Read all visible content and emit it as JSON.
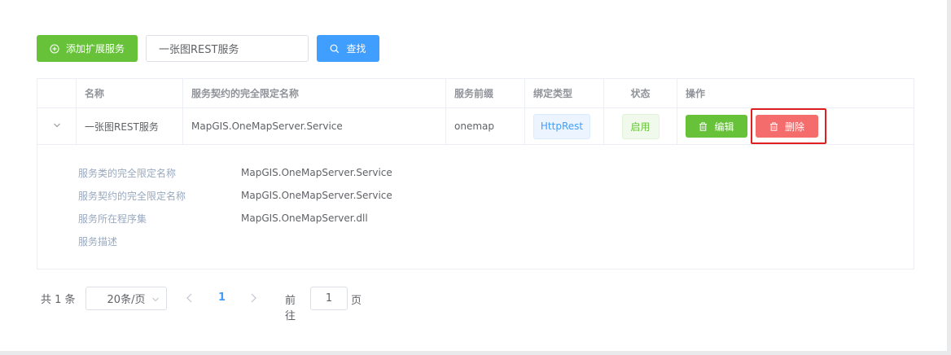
{
  "toolbar": {
    "add_label": "添加扩展服务",
    "search_value": "一张图REST服务",
    "search_label": "查找"
  },
  "table": {
    "headers": [
      "名称",
      "服务契约的完全限定名称",
      "服务前缀",
      "绑定类型",
      "状态",
      "操作"
    ],
    "rows": [
      {
        "name": "一张图REST服务",
        "contract": "MapGIS.OneMapServer.Service",
        "prefix": "onemap",
        "binding": "HttpRest",
        "status": "启用",
        "edit_label": "编辑",
        "delete_label": "删除"
      }
    ],
    "details": [
      {
        "label": "服务类的完全限定名称",
        "value": "MapGIS.OneMapServer.Service"
      },
      {
        "label": "服务契约的完全限定名称",
        "value": "MapGIS.OneMapServer.Service"
      },
      {
        "label": "服务所在程序集",
        "value": "MapGIS.OneMapServer.dll"
      },
      {
        "label": "服务描述",
        "value": ""
      }
    ]
  },
  "pagination": {
    "total": "共 1 条",
    "page_size": "20条/页",
    "current_page": "1",
    "goto_label": "前往",
    "goto_value": "1",
    "goto_unit": "页"
  },
  "colors": {
    "success": "#67c23a",
    "primary": "#409eff",
    "danger": "#f56c6c",
    "highlight": "#e02020"
  }
}
